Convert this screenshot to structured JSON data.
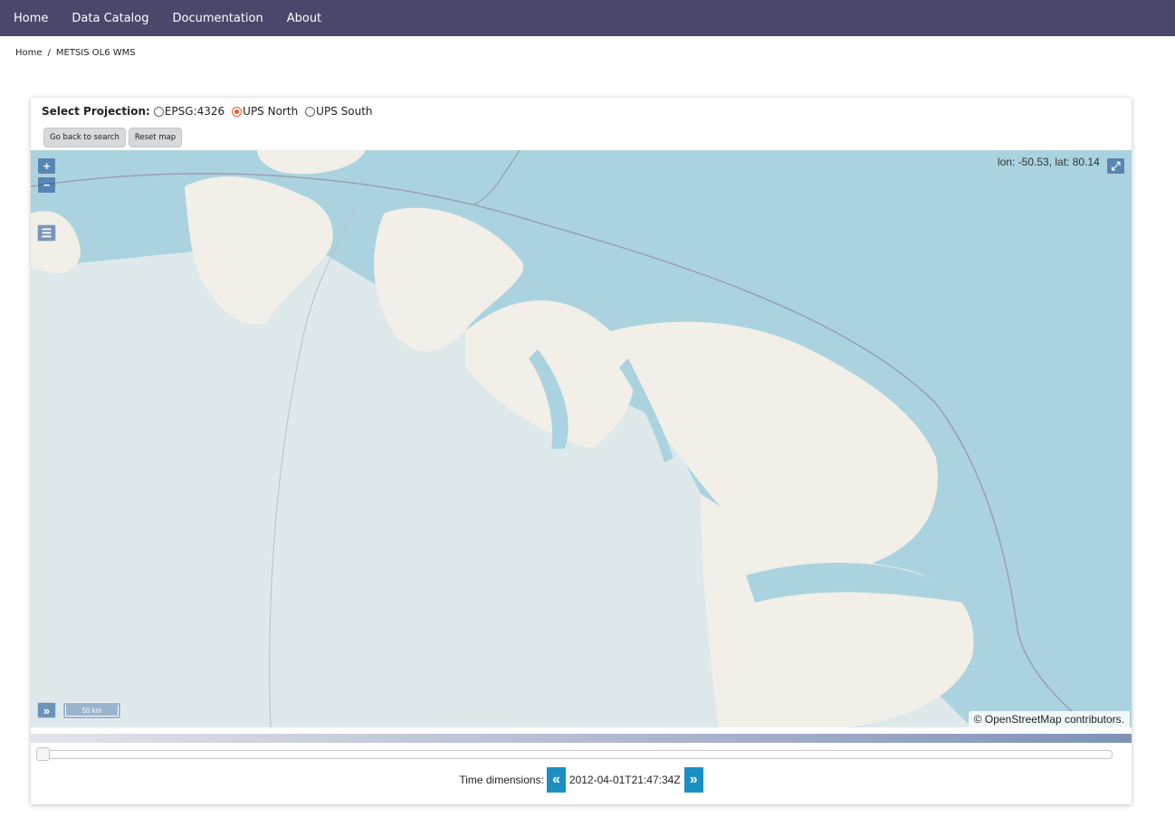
{
  "nav": {
    "items": [
      "Home",
      "Data Catalog",
      "Documentation",
      "About"
    ]
  },
  "breadcrumb": {
    "home": "Home",
    "separator": "/",
    "current": "METSIS OL6 WMS"
  },
  "projection": {
    "label": "Select Projection:",
    "options": [
      {
        "label": "EPSG:4326",
        "checked": false
      },
      {
        "label": "UPS North",
        "checked": true
      },
      {
        "label": "UPS South",
        "checked": false
      }
    ]
  },
  "buttons": {
    "back": "Go back to search",
    "reset": "Reset map"
  },
  "map": {
    "zoom_in": "+",
    "zoom_out": "−",
    "layers_icon": "☰",
    "fullscreen_icon": "⤢",
    "expand_icon": "»",
    "coords": "lon: -50.53, lat: 80.14",
    "scale": "50 km",
    "attribution": "© OpenStreetMap contributors.",
    "colors": {
      "sea": "#aad3df",
      "land": "#f2efe9",
      "ice": "#dde9ea"
    }
  },
  "time": {
    "label": "Time dimensions:",
    "value": "2012-04-01T21:47:34Z",
    "prev_icon": "«",
    "next_icon": "»",
    "slider_position": 0
  }
}
